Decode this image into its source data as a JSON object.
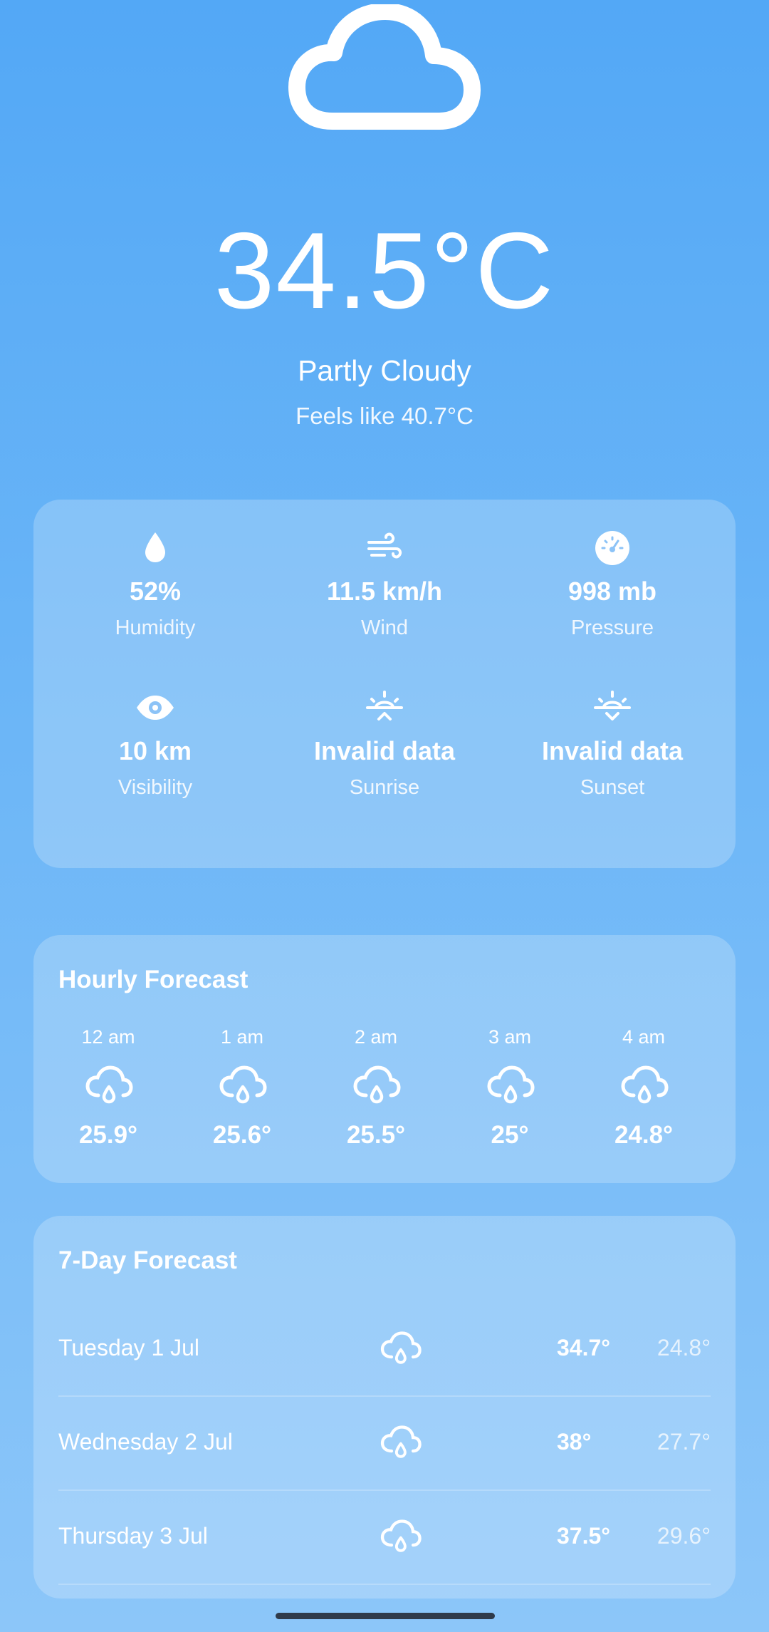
{
  "current": {
    "icon": "cloud-icon",
    "temperature": "34.5°C",
    "condition": "Partly Cloudy",
    "feels_like": "Feels like 40.7°C"
  },
  "details": [
    {
      "icon": "droplet-icon",
      "value": "52%",
      "label": "Humidity"
    },
    {
      "icon": "wind-icon",
      "value": "11.5 km/h",
      "label": "Wind"
    },
    {
      "icon": "gauge-icon",
      "value": "998 mb",
      "label": "Pressure"
    },
    {
      "icon": "eye-icon",
      "value": "10 km",
      "label": "Visibility"
    },
    {
      "icon": "sunrise-icon",
      "value": "Invalid data",
      "label": "Sunrise"
    },
    {
      "icon": "sunset-icon",
      "value": "Invalid data",
      "label": "Sunset"
    }
  ],
  "hourly": {
    "title": "Hourly Forecast",
    "items": [
      {
        "time": "12 am",
        "icon": "cloud-rain-icon",
        "temp": "25.9°"
      },
      {
        "time": "1 am",
        "icon": "cloud-rain-icon",
        "temp": "25.6°"
      },
      {
        "time": "2 am",
        "icon": "cloud-rain-icon",
        "temp": "25.5°"
      },
      {
        "time": "3 am",
        "icon": "cloud-rain-icon",
        "temp": "25°"
      },
      {
        "time": "4 am",
        "icon": "cloud-rain-icon",
        "temp": "24.8°"
      }
    ]
  },
  "weekly": {
    "title": "7-Day Forecast",
    "days": [
      {
        "day": "Tuesday 1 Jul",
        "icon": "cloud-rain-icon",
        "high": "34.7°",
        "low": "24.8°"
      },
      {
        "day": "Wednesday 2 Jul",
        "icon": "cloud-rain-icon",
        "high": "38°",
        "low": "27.7°"
      },
      {
        "day": "Thursday 3 Jul",
        "icon": "cloud-rain-icon",
        "high": "37.5°",
        "low": "29.6°"
      }
    ]
  }
}
